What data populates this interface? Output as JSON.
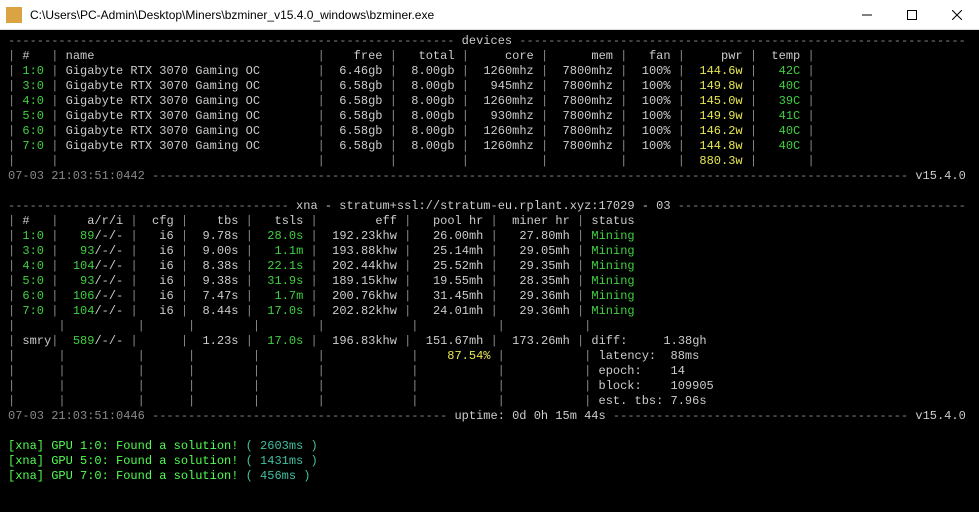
{
  "title": "C:\\Users\\PC-Admin\\Desktop\\Miners\\bzminer_v15.4.0_windows\\bzminer.exe",
  "section1": {
    "header": "devices",
    "cols": [
      "#",
      "name",
      "free",
      "total",
      "core",
      "mem",
      "fan",
      "pwr",
      "temp"
    ],
    "rows": [
      {
        "id": "1:0",
        "name": "Gigabyte RTX 3070 Gaming OC",
        "free": "6.46gb",
        "total": "8.00gb",
        "core": "1260mhz",
        "mem": "7800mhz",
        "fan": "100%",
        "pwr": "144.6w",
        "temp": "42C"
      },
      {
        "id": "3:0",
        "name": "Gigabyte RTX 3070 Gaming OC",
        "free": "6.58gb",
        "total": "8.00gb",
        "core": "945mhz",
        "mem": "7800mhz",
        "fan": "100%",
        "pwr": "149.8w",
        "temp": "40C"
      },
      {
        "id": "4:0",
        "name": "Gigabyte RTX 3070 Gaming OC",
        "free": "6.58gb",
        "total": "8.00gb",
        "core": "1260mhz",
        "mem": "7800mhz",
        "fan": "100%",
        "pwr": "145.0w",
        "temp": "39C"
      },
      {
        "id": "5:0",
        "name": "Gigabyte RTX 3070 Gaming OC",
        "free": "6.58gb",
        "total": "8.00gb",
        "core": "930mhz",
        "mem": "7800mhz",
        "fan": "100%",
        "pwr": "149.9w",
        "temp": "41C"
      },
      {
        "id": "6:0",
        "name": "Gigabyte RTX 3070 Gaming OC",
        "free": "6.58gb",
        "total": "8.00gb",
        "core": "1260mhz",
        "mem": "7800mhz",
        "fan": "100%",
        "pwr": "146.2w",
        "temp": "40C"
      },
      {
        "id": "7:0",
        "name": "Gigabyte RTX 3070 Gaming OC",
        "free": "6.58gb",
        "total": "8.00gb",
        "core": "1260mhz",
        "mem": "7800mhz",
        "fan": "100%",
        "pwr": "144.8w",
        "temp": "40C"
      }
    ],
    "total_pwr": "880.3w",
    "timestamp": "07-03 21:03:51:0442",
    "version": "v15.4.0"
  },
  "section2": {
    "header": "xna - stratum+ssl://stratum-eu.rplant.xyz:17029 - 03",
    "cols": [
      "#",
      "a/r/i",
      "cfg",
      "tbs",
      "tsls",
      "eff",
      "pool hr",
      "miner hr",
      "status"
    ],
    "rows": [
      {
        "id": "1:0",
        "a": "89",
        "r": "/-/-",
        "cfg": "i6",
        "tbs": "9.78s",
        "tsls": "28.0s",
        "eff": "192.23khw",
        "pool": "26.00mh",
        "miner": "27.80mh",
        "status": "Mining"
      },
      {
        "id": "3:0",
        "a": "93",
        "r": "/-/-",
        "cfg": "i6",
        "tbs": "9.00s",
        "tsls": "1.1m",
        "eff": "193.88khw",
        "pool": "25.14mh",
        "miner": "29.05mh",
        "status": "Mining"
      },
      {
        "id": "4:0",
        "a": "104",
        "r": "/-/-",
        "cfg": "i6",
        "tbs": "8.38s",
        "tsls": "22.1s",
        "eff": "202.44khw",
        "pool": "25.52mh",
        "miner": "29.35mh",
        "status": "Mining"
      },
      {
        "id": "5:0",
        "a": "93",
        "r": "/-/-",
        "cfg": "i6",
        "tbs": "9.38s",
        "tsls": "31.9s",
        "eff": "189.15khw",
        "pool": "19.55mh",
        "miner": "28.35mh",
        "status": "Mining"
      },
      {
        "id": "6:0",
        "a": "106",
        "r": "/-/-",
        "cfg": "i6",
        "tbs": "7.47s",
        "tsls": "1.7m",
        "eff": "200.76khw",
        "pool": "31.45mh",
        "miner": "29.36mh",
        "status": "Mining"
      },
      {
        "id": "7:0",
        "a": "104",
        "r": "/-/-",
        "cfg": "i6",
        "tbs": "8.44s",
        "tsls": "17.0s",
        "eff": "202.82khw",
        "pool": "24.01mh",
        "miner": "29.36mh",
        "status": "Mining"
      }
    ],
    "summary": {
      "label": "smry",
      "a": "589",
      "r": "/-/-",
      "tbs": "1.23s",
      "tsls": "17.0s",
      "eff": "196.83khw",
      "pool": "151.67mh",
      "pct": "87.54%",
      "miner": "173.26mh"
    },
    "stats": [
      {
        "label": "diff:",
        "value": "1.38gh"
      },
      {
        "label": "latency:",
        "value": "88ms"
      },
      {
        "label": "epoch:",
        "value": "14"
      },
      {
        "label": "block:",
        "value": "109905"
      },
      {
        "label": "est. tbs:",
        "value": "7.96s"
      }
    ],
    "timestamp": "07-03 21:03:51:0446",
    "uptime": "uptime: 0d 0h 15m 44s",
    "version": "v15.4.0"
  },
  "log": [
    {
      "prefix": "[xna] GPU 1:0: Found a solution!",
      "paren": "( 2603ms )"
    },
    {
      "prefix": "[xna] GPU 5:0: Found a solution!",
      "paren": "( 1431ms )"
    },
    {
      "prefix": "[xna] GPU 7:0: Found a solution!",
      "paren": "( 456ms )"
    }
  ]
}
